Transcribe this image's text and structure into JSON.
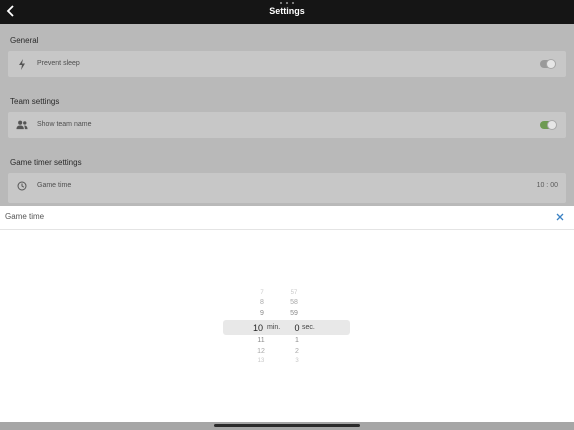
{
  "header": {
    "title": "Settings"
  },
  "sections": {
    "general": {
      "title": "General",
      "prevent_sleep": {
        "label": "Prevent sleep",
        "enabled": false
      }
    },
    "team": {
      "title": "Team settings",
      "show_team_name": {
        "label": "Show team name",
        "enabled": true
      }
    },
    "game_timer": {
      "title": "Game timer settings",
      "game_time": {
        "label": "Game time",
        "value": "10 : 00"
      }
    }
  },
  "sheet": {
    "title": "Game time",
    "minutes": {
      "above": [
        "7",
        "8",
        "9"
      ],
      "selected": "10",
      "below": [
        "11",
        "12",
        "13"
      ],
      "unit": "min."
    },
    "seconds": {
      "above": [
        "57",
        "58",
        "59"
      ],
      "selected": "0",
      "below": [
        "1",
        "2",
        "3"
      ],
      "unit": "sec."
    }
  },
  "colors": {
    "toggle_on": "#6e9a52",
    "close_icon": "#3b82c4",
    "topbar": "#151515"
  }
}
